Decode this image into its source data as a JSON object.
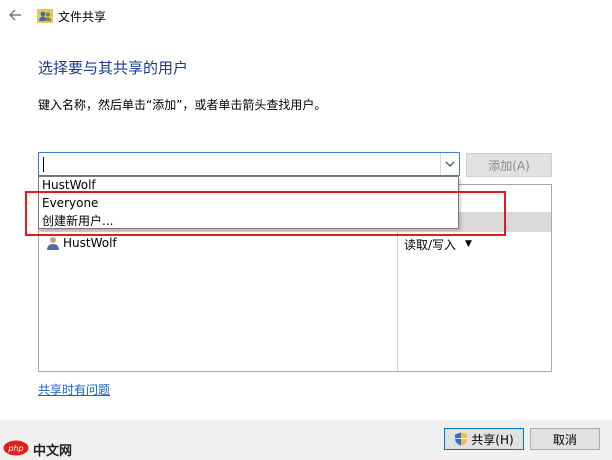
{
  "window": {
    "title": "文件共享",
    "back_icon": "back-arrow-icon",
    "app_icon": "users-share-icon"
  },
  "main": {
    "heading": "选择要与其共享的用户",
    "instruction": "键入名称，然后单击“添加”，或者单击箭头查找用户。",
    "name_input_value": "",
    "add_button_label": "添加(A)",
    "help_link": "共享时有问题"
  },
  "dropdown": {
    "items": [
      "HustWolf",
      "Everyone",
      "创建新用户..."
    ]
  },
  "list": {
    "rows": [
      {
        "name": "HustWolf",
        "permission": "读取/写入"
      }
    ]
  },
  "footer": {
    "share_label": "共享(H)",
    "cancel_label": "取消"
  },
  "watermark": {
    "logo": "php",
    "text": "中文网"
  },
  "colors": {
    "heading": "#1a3b8f",
    "link": "#1a63c4",
    "highlight_box": "#e21b1b",
    "focus_border": "#3c7fd1"
  }
}
